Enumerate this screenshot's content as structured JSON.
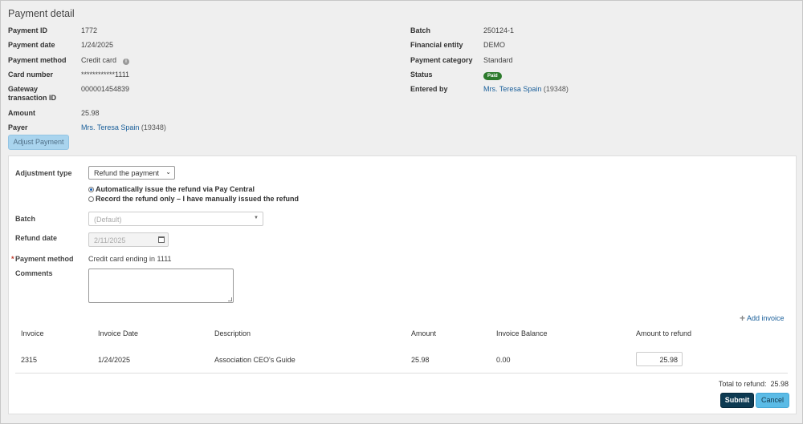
{
  "page": {
    "title": "Payment detail"
  },
  "details_left": {
    "payment_id": {
      "label": "Payment ID",
      "value": "1772"
    },
    "payment_date": {
      "label": "Payment date",
      "value": "1/24/2025"
    },
    "payment_method": {
      "label": "Payment method",
      "value": "Credit card",
      "icon": "info-icon"
    },
    "card_number": {
      "label": "Card number",
      "value": "************1111"
    },
    "gateway_id": {
      "label": "Gateway transaction ID",
      "value": "000001454839"
    },
    "amount": {
      "label": "Amount",
      "value": "25.98"
    },
    "payer": {
      "label": "Payer",
      "name": "Mrs. Teresa Spain",
      "id": "(19348)"
    }
  },
  "details_right": {
    "batch": {
      "label": "Batch",
      "value": "250124-1"
    },
    "financial_entity": {
      "label": "Financial entity",
      "value": "DEMO"
    },
    "payment_category": {
      "label": "Payment category",
      "value": "Standard"
    },
    "status": {
      "label": "Status",
      "value": "Paid",
      "color": "#2c7a2c"
    },
    "entered_by": {
      "label": "Entered by",
      "name": "Mrs. Teresa Spain",
      "id": "(19348)"
    }
  },
  "adjust_button": {
    "label": "Adjust Payment"
  },
  "form": {
    "adjustment_type": {
      "label": "Adjustment type",
      "selected": "Refund the payment"
    },
    "radio_auto": {
      "label": "Automatically issue the refund via Pay Central",
      "checked": true
    },
    "radio_manual": {
      "label": "Record the refund only – I have manually issued the refund",
      "checked": false
    },
    "batch": {
      "label": "Batch",
      "placeholder": "(Default)"
    },
    "refund_date": {
      "label": "Refund date",
      "value": "2/11/2025"
    },
    "payment_method": {
      "label": "Payment method",
      "required_mark": "*",
      "value": "Credit card ending in 1111"
    },
    "comments": {
      "label": "Comments",
      "value": ""
    }
  },
  "add_invoice": {
    "label": "Add invoice"
  },
  "table": {
    "headers": [
      "Invoice",
      "Invoice Date",
      "Description",
      "Amount",
      "Invoice Balance",
      "Amount to refund"
    ],
    "rows": [
      {
        "invoice": "2315",
        "date": "1/24/2025",
        "description": "Association CEO's Guide",
        "amount": "25.98",
        "balance": "0.00",
        "refund": "25.98"
      }
    ]
  },
  "total": {
    "label": "Total to refund:",
    "value": "25.98"
  },
  "actions": {
    "submit": "Submit",
    "cancel": "Cancel"
  },
  "colors": {
    "link": "#1a5f9a",
    "primary": "#0d3a52",
    "secondary": "#5bbbe6"
  }
}
